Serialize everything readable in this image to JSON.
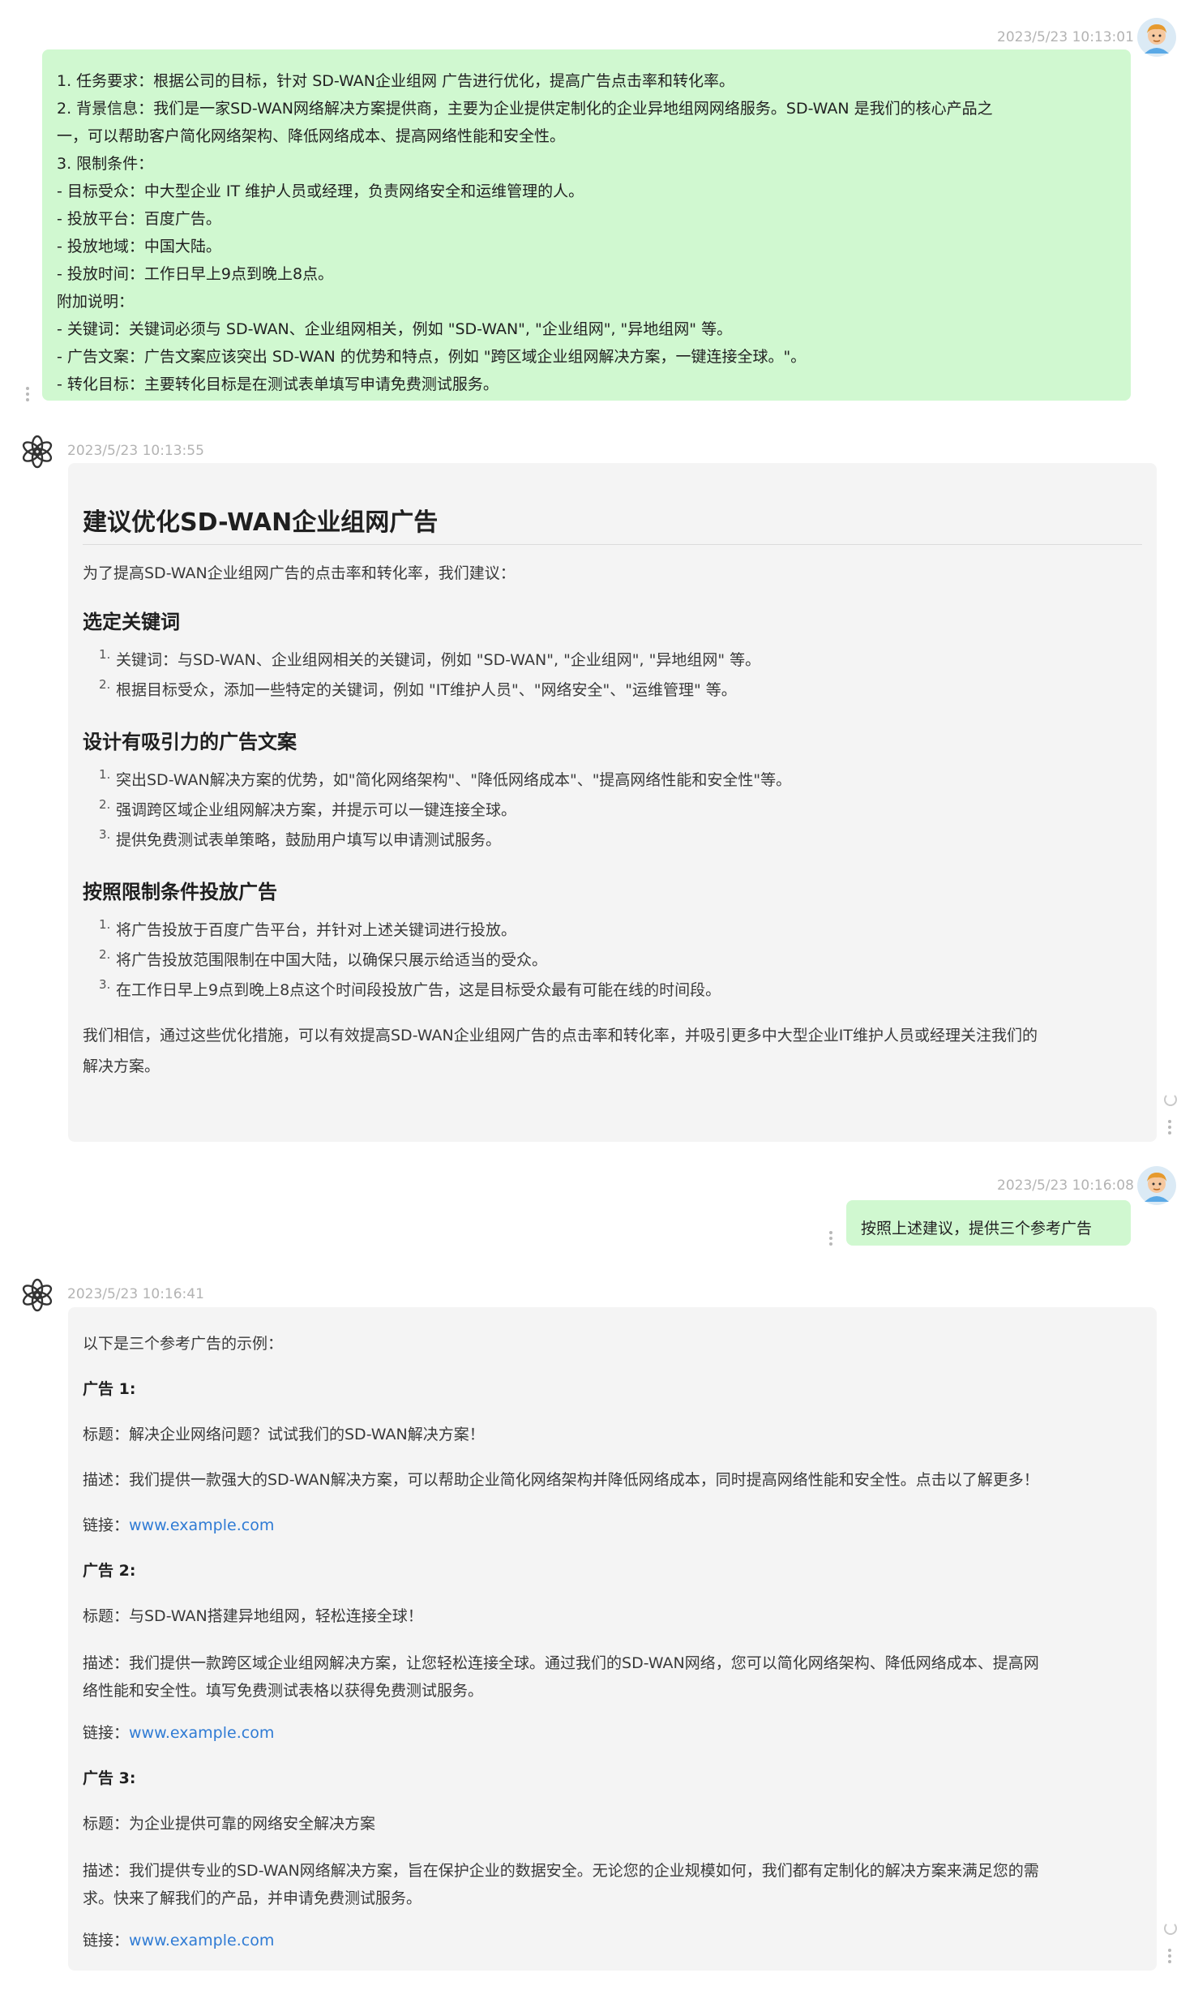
{
  "conversation": {
    "msg1": {
      "timestamp": "2023/5/23 10:13:01",
      "lines": [
        "1. 任务要求：根据公司的目标，针对 SD-WAN企业组网 广告进行优化，提高广告点击率和转化率。",
        "2. 背景信息：我们是一家SD-WAN网络解决方案提供商，主要为企业提供定制化的企业异地组网网络服务。SD-WAN 是我们的核心产品之",
        "一，可以帮助客户简化网络架构、降低网络成本、提高网络性能和安全性。",
        "3. 限制条件：",
        "- 目标受众：中大型企业 IT 维护人员或经理，负责网络安全和运维管理的人。",
        "- 投放平台：百度广告。",
        "- 投放地域：中国大陆。",
        "- 投放时间：工作日早上9点到晚上8点。",
        "附加说明：",
        "- 关键词：关键词必须与 SD-WAN、企业组网相关，例如 \"SD-WAN\", \"企业组网\", \"异地组网\" 等。",
        "- 广告文案：广告文案应该突出 SD-WAN 的优势和特点，例如 \"跨区域企业组网解决方案，一键连接全球。\"。",
        "- 转化目标：主要转化目标是在测试表单填写申请免费测试服务。"
      ]
    },
    "msg2": {
      "timestamp": "2023/5/23 10:13:55",
      "title": "建议优化SD-WAN企业组网广告",
      "intro": "为了提高SD-WAN企业组网广告的点击率和转化率，我们建议：",
      "sections": [
        {
          "heading": "选定关键词",
          "items": [
            "关键词：与SD-WAN、企业组网相关的关键词，例如 \"SD-WAN\", \"企业组网\", \"异地组网\" 等。",
            "根据目标受众，添加一些特定的关键词，例如 \"IT维护人员\"、\"网络安全\"、\"运维管理\" 等。"
          ]
        },
        {
          "heading": "设计有吸引力的广告文案",
          "items": [
            "突出SD-WAN解决方案的优势，如\"简化网络架构\"、\"降低网络成本\"、\"提高网络性能和安全性\"等。",
            "强调跨区域企业组网解决方案，并提示可以一键连接全球。",
            "提供免费测试表单策略，鼓励用户填写以申请测试服务。"
          ]
        },
        {
          "heading": "按照限制条件投放广告",
          "items": [
            "将广告投放于百度广告平台，并针对上述关键词进行投放。",
            "将广告投放范围限制在中国大陆，以确保只展示给适当的受众。",
            "在工作日早上9点到晚上8点这个时间段投放广告，这是目标受众最有可能在线的时间段。"
          ]
        }
      ],
      "conclusion_line1": "我们相信，通过这些优化措施，可以有效提高SD-WAN企业组网广告的点击率和转化率，并吸引更多中大型企业IT维护人员或经理关注我们的",
      "conclusion_line2": "解决方案。"
    },
    "msg3": {
      "timestamp": "2023/5/23 10:16:08",
      "text": "按照上述建议，提供三个参考广告"
    },
    "msg4": {
      "timestamp": "2023/5/23 10:16:41",
      "intro": "以下是三个参考广告的示例：",
      "ad1": {
        "label": "广告 1:",
        "title": "标题：解决企业网络问题？试试我们的SD-WAN解决方案！",
        "desc1": "描述：我们提供一款强大的SD-WAN解决方案，可以帮助企业简化网络架构并降低网络成本，同时提高网络性能和安全性。点击以了解更多！",
        "link_prefix": "链接：",
        "link": "www.example.com"
      },
      "ad2": {
        "label": "广告 2:",
        "title": "标题：与SD-WAN搭建异地组网，轻松连接全球！",
        "desc1": "描述：我们提供一款跨区域企业组网解决方案，让您轻松连接全球。通过我们的SD-WAN网络，您可以简化网络架构、降低网络成本、提高网",
        "desc2": "络性能和安全性。填写免费测试表格以获得免费测试服务。",
        "link_prefix": "链接：",
        "link": "www.example.com"
      },
      "ad3": {
        "label": "广告 3:",
        "title": "标题：为企业提供可靠的网络安全解决方案",
        "desc1": "描述：我们提供专业的SD-WAN网络解决方案，旨在保护企业的数据安全。无论您的企业规模如何，我们都有定制化的解决方案来满足您的需",
        "desc2": "求。快来了解我们的产品，并申请免费测试服务。",
        "link_prefix": "链接：",
        "link": "www.example.com"
      }
    }
  },
  "colors": {
    "user_bubble": "#d0f8d0",
    "bot_bubble": "#f4f4f4",
    "link": "#2f7bd4"
  },
  "icons": {
    "user_avatar": "user-avatar-icon",
    "bot_avatar": "openai-logo-icon",
    "more": "more-vertical-icon",
    "regenerate": "refresh-icon"
  }
}
